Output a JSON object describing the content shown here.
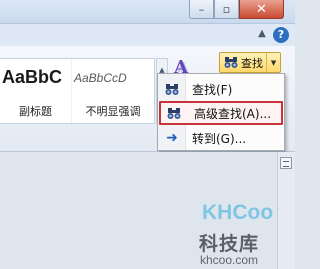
{
  "window": {
    "minimize_symbol": "–",
    "maximize_symbol": "▫",
    "close_symbol": "✕"
  },
  "ribbon": {
    "styles": [
      {
        "sample": "AaBbC",
        "name": "副标题"
      },
      {
        "sample": "AaBbCcD",
        "name": "不明显强调"
      }
    ],
    "find_button": {
      "label": "查找"
    }
  },
  "find_menu": {
    "items": [
      {
        "label": "查找(F)",
        "icon": "binoculars-icon"
      },
      {
        "label": "高级查找(A)...",
        "icon": "binoculars-icon",
        "highlighted": true
      },
      {
        "label": "转到(G)...",
        "icon": "arrow-right-icon"
      }
    ]
  },
  "watermark": {
    "logo": "KHCoo",
    "title": "科技库",
    "url": "khcoo.com"
  },
  "colors": {
    "highlight_border": "#c8323a",
    "find_button_bg": "#ffd86a",
    "close_button": "#c84a31"
  }
}
